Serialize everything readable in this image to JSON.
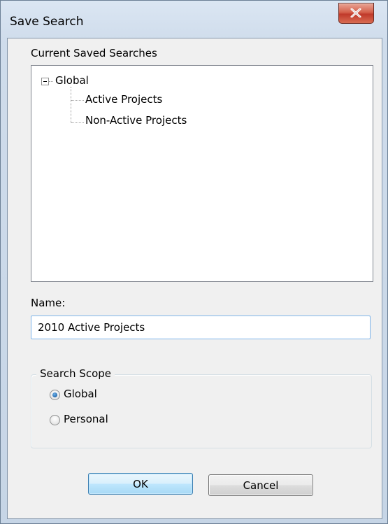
{
  "window": {
    "title": "Save Search",
    "close_glyph": "X"
  },
  "saved_searches": {
    "label": "Current Saved Searches",
    "tree": {
      "root": {
        "label": "Global",
        "expanded": true,
        "expander_glyph": "−"
      },
      "children": [
        {
          "label": "Active Projects"
        },
        {
          "label": "Non-Active Projects"
        }
      ]
    }
  },
  "name_field": {
    "label": "Name:",
    "value": "2010 Active Projects"
  },
  "search_scope": {
    "legend": "Search Scope",
    "options": [
      {
        "label": "Global",
        "checked": true
      },
      {
        "label": "Personal",
        "checked": false
      }
    ]
  },
  "buttons": {
    "ok_label": "OK",
    "cancel_label": "Cancel"
  },
  "icons": {
    "close": "close-icon",
    "expander": "tree-collapse-icon"
  }
}
